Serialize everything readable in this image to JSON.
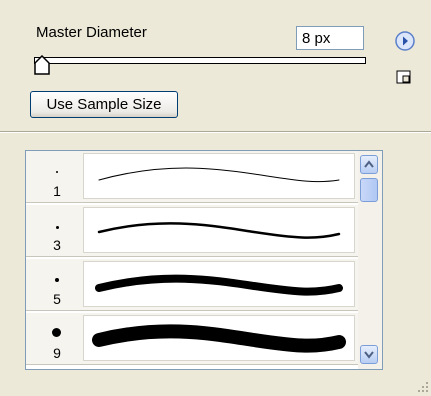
{
  "master_diameter": {
    "label": "Master Diameter",
    "value": "8 px"
  },
  "slider": {
    "value_fraction": 0.0
  },
  "sample_button_label": "Use Sample Size",
  "icons": {
    "menu_arrow": "right-arrow-circle-icon",
    "new_preset": "new-preset-icon",
    "scroll_up": "chevron-up-icon",
    "scroll_down": "chevron-down-icon",
    "grip": "resize-grip-icon"
  },
  "brushes": [
    {
      "size": "1"
    },
    {
      "size": "3"
    },
    {
      "size": "5"
    },
    {
      "size": "9"
    }
  ],
  "colors": {
    "panel_bg": "#ece9d8",
    "accent": "#316ac5",
    "border": "#7f9db9"
  }
}
